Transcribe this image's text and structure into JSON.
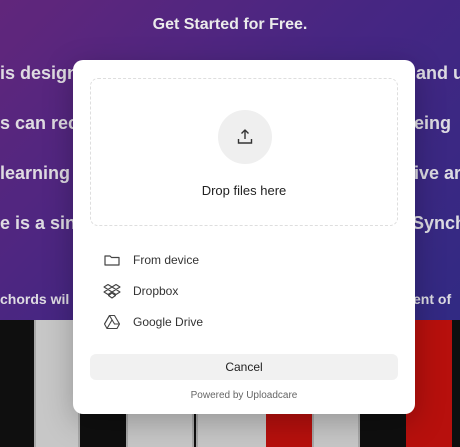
{
  "background": {
    "title": "Get Started for Free.",
    "lines": [
      {
        "left": "is design",
        "right": "and u"
      },
      {
        "left": "s can rec",
        "right": "eing"
      },
      {
        "left": " learning",
        "right": "ive ar"
      },
      {
        "left": "e is a sin",
        "right": "Synch"
      },
      {
        "left": "chords wil",
        "right": "ent of"
      }
    ]
  },
  "modal": {
    "drop_label": "Drop files here",
    "sources": [
      {
        "label": "From device",
        "icon": "folder-icon"
      },
      {
        "label": "Dropbox",
        "icon": "dropbox-icon"
      },
      {
        "label": "Google Drive",
        "icon": "google-drive-icon"
      }
    ],
    "cancel_label": "Cancel",
    "powered_by": "Powered by Uploadcare"
  }
}
